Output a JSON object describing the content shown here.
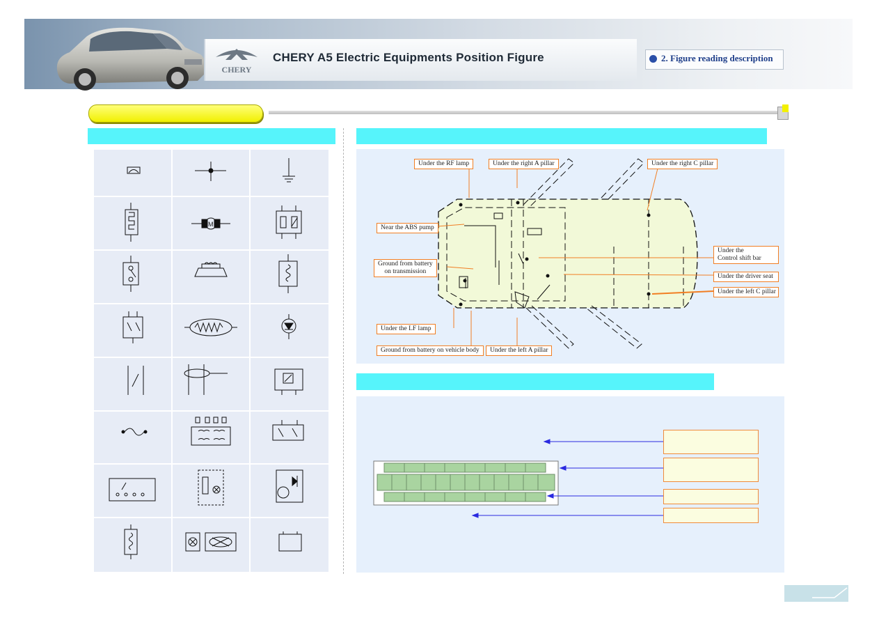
{
  "header": {
    "brand_text": "CHERY",
    "title": "CHERY A5 Electric Equipments Position Figure",
    "section_tag": "2.   Figure reading description"
  },
  "ground_labels": {
    "rf_lamp": "Under the RF lamp",
    "right_a_pillar": "Under the right A pillar",
    "right_c_pillar": "Under the right C pillar",
    "abs_pump": "Near the ABS pump",
    "ground_transmission_1": "Ground from battery",
    "ground_transmission_2": "on transmission",
    "control_shift_1": "Under the",
    "control_shift_2": "Control shift bar",
    "driver_seat": "Under the driver seat",
    "left_c_pillar": "Under the left C pillar",
    "lf_lamp": "Under the LF lamp",
    "ground_body": "Ground from battery  on vehicle body",
    "left_a_pillar": "Under the left A pillar"
  },
  "colors": {
    "highlight": "#f1f000",
    "section_bar": "#56f4fb",
    "panel": "#e6f0fc",
    "label_border": "#f17e23",
    "arrow": "#2a2ae0"
  }
}
